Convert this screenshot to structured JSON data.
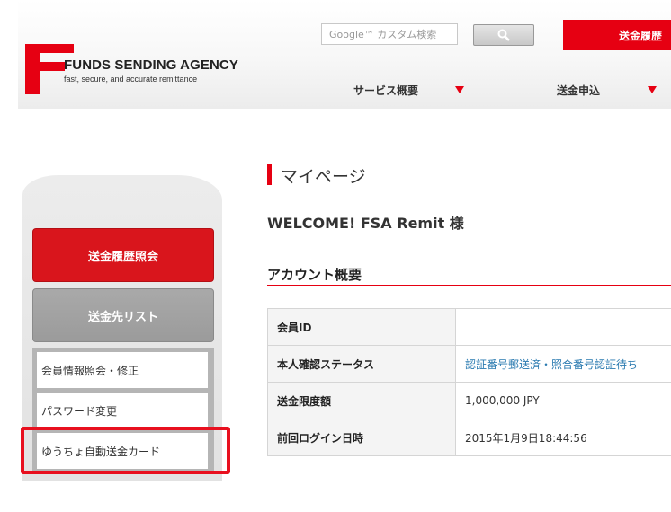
{
  "header": {
    "logo_name": "FUNDS SENDING AGENCY",
    "logo_tagline": "fast, secure, and accurate remittance",
    "search_placeholder": "Google™ カスタム検索",
    "history_button": "送金履歴",
    "nav": [
      {
        "label": "サービス概要"
      },
      {
        "label": "送金申込"
      }
    ]
  },
  "sidebar": {
    "primary_button": "送金履歴照会",
    "secondary_button": "送金先リスト",
    "links": [
      {
        "label": "会員情報照会・修正"
      },
      {
        "label": "パスワード変更"
      },
      {
        "label": "ゆうちょ自動送金カード"
      }
    ]
  },
  "main": {
    "page_title": "マイページ",
    "welcome": "WELCOME! FSA Remit 様",
    "section_title": "アカウント概要",
    "rows": [
      {
        "label": "会員ID",
        "value": ""
      },
      {
        "label": "本人確認ステータス",
        "value": "認証番号郵送済・照合番号認証待ち"
      },
      {
        "label": "送金限度額",
        "value": "1,000,000 JPY"
      },
      {
        "label": "前回ログイン日時",
        "value": "2015年1月9日18:44:56"
      }
    ]
  },
  "colors": {
    "brand_red": "#e60012",
    "link_blue": "#2a7ab0",
    "highlight_red": "#e8101f"
  },
  "icons": {
    "search": "search-icon",
    "dropdown": "triangle-down-icon",
    "logo": "fsa-f-logo"
  }
}
